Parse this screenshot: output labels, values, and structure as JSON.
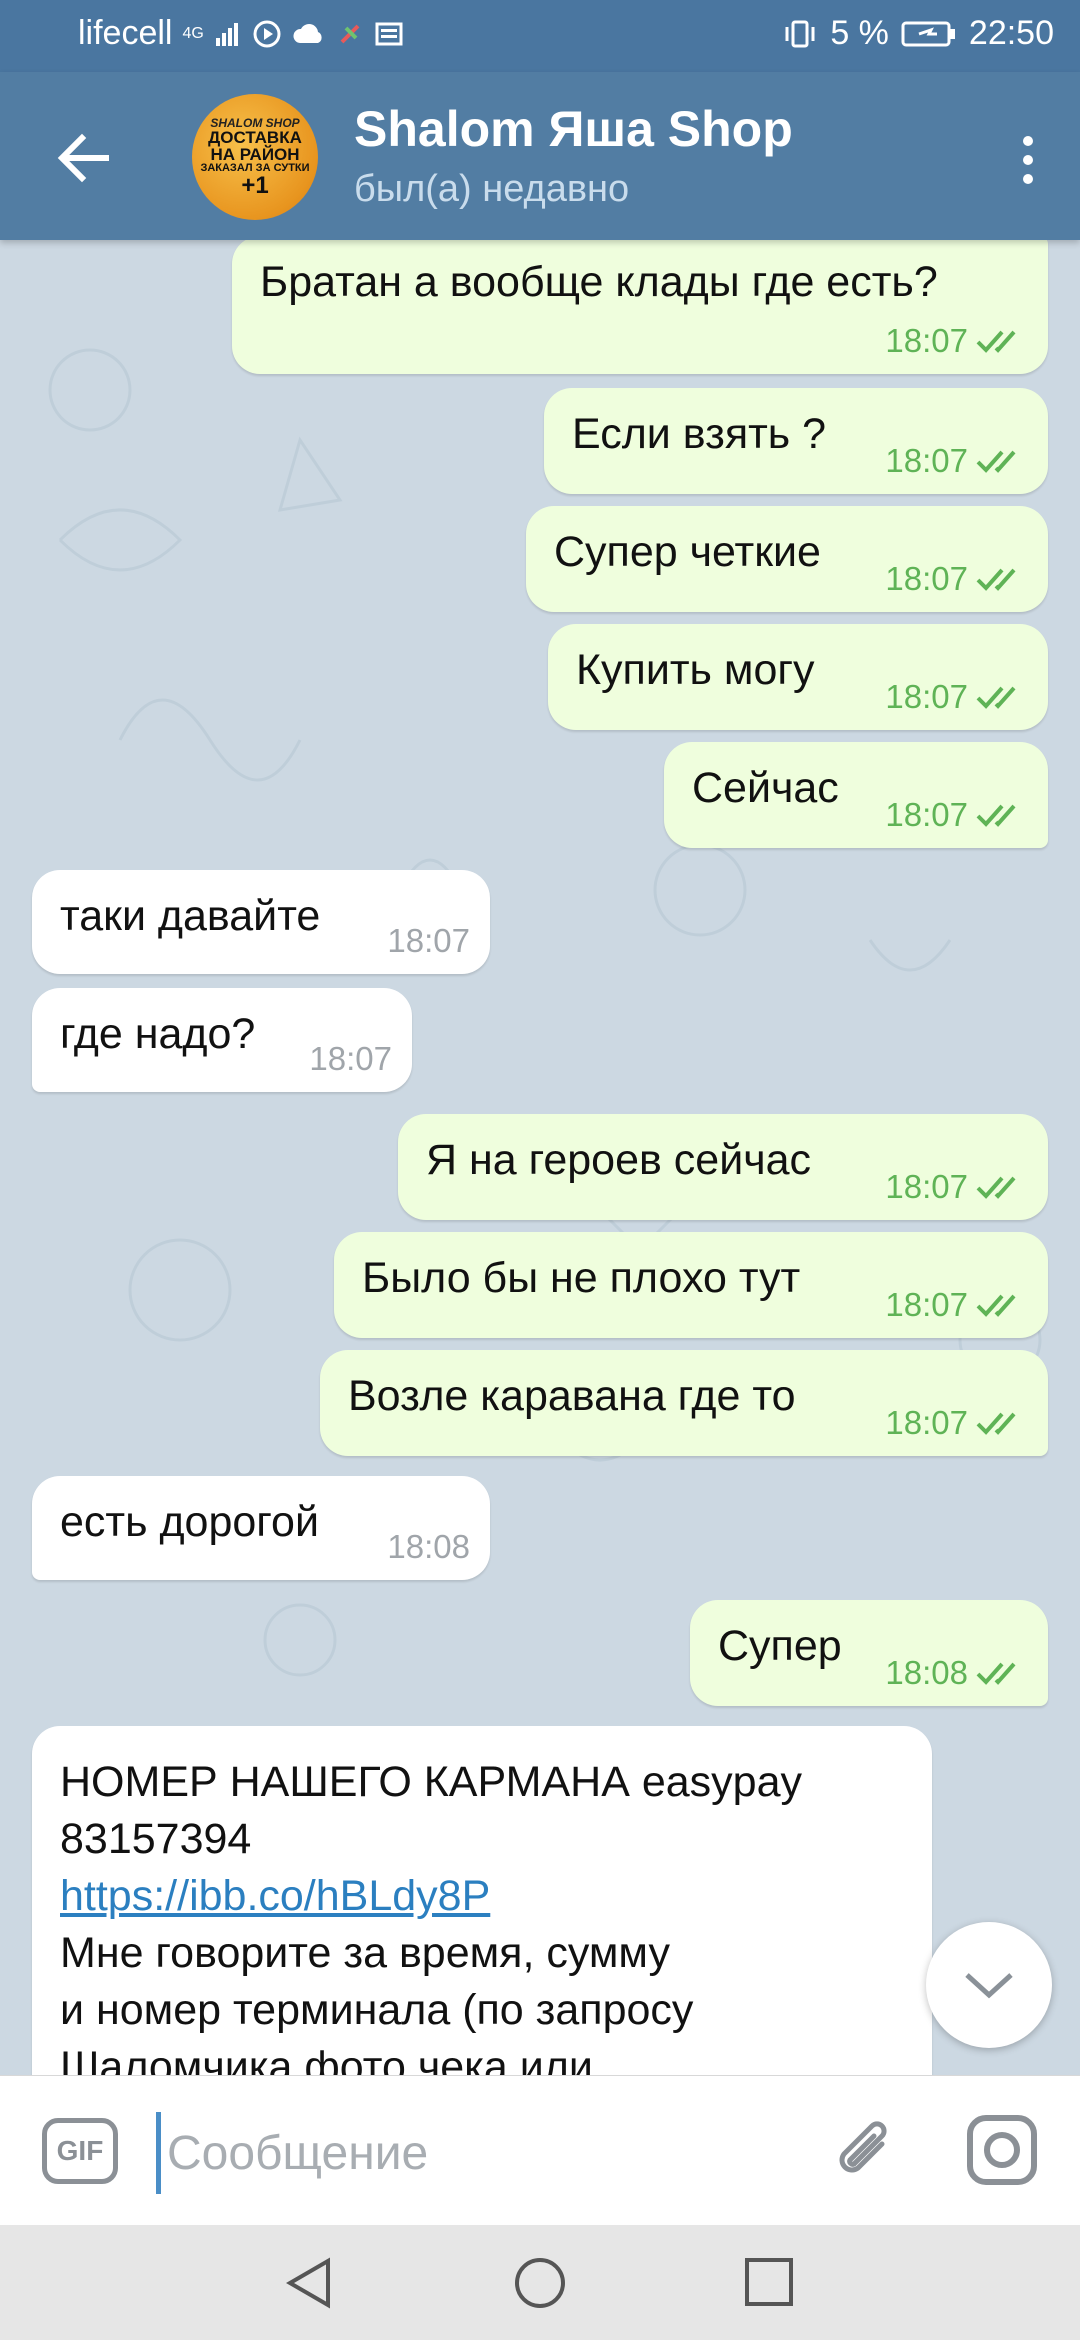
{
  "status": {
    "carrier": "lifecell",
    "network": "4G",
    "battery": "5 %",
    "time": "22:50"
  },
  "header": {
    "title": "Shalom Яша Shop",
    "subtitle": "был(а) недавно",
    "avatar_lines": [
      "SHALOM SHOP",
      "ДОСТАВКА",
      "НА РАЙОН",
      "ЗАКАЗАЛ ЗА СУТКИ",
      "+1"
    ]
  },
  "messages": [
    {
      "dir": "out",
      "text": "Братан а вообще клады где есть?",
      "time": "18:07"
    },
    {
      "dir": "out",
      "text": "Если взять ?",
      "time": "18:07"
    },
    {
      "dir": "out",
      "text": "Супер четкие",
      "time": "18:07"
    },
    {
      "dir": "out",
      "text": "Купить могу",
      "time": "18:07"
    },
    {
      "dir": "out",
      "text": "Сейчас",
      "time": "18:07"
    },
    {
      "dir": "in",
      "text": "таки давайте",
      "time": "18:07"
    },
    {
      "dir": "in",
      "text": "где надо?",
      "time": "18:07"
    },
    {
      "dir": "out",
      "text": "Я на героев сейчас",
      "time": "18:07"
    },
    {
      "dir": "out",
      "text": "Было бы не плохо тут",
      "time": "18:07"
    },
    {
      "dir": "out",
      "text": "Возле каравана где то",
      "time": "18:07"
    },
    {
      "dir": "in",
      "text": "есть дорогой",
      "time": "18:08"
    },
    {
      "dir": "out",
      "text": "Супер",
      "time": "18:08"
    }
  ],
  "long_message": {
    "line1": "НОМЕР НАШЕГО КАРМАНА easypay",
    "line2": "83157394",
    "link": "https://ibb.co/hBLdy8P",
    "line4": "Мне говорите за время, сумму",
    "line5": "и номер терминала (по запросу",
    "line6": "Шаломчика фото чека или"
  },
  "input": {
    "gif_label": "GIF",
    "placeholder": "Сообщение"
  },
  "colors": {
    "header": "#527da3",
    "status_bar": "#4a76a0",
    "outgoing_bubble": "#effedd",
    "incoming_bubble": "#ffffff",
    "check_color": "#5fb356",
    "link": "#2b7fc0"
  }
}
